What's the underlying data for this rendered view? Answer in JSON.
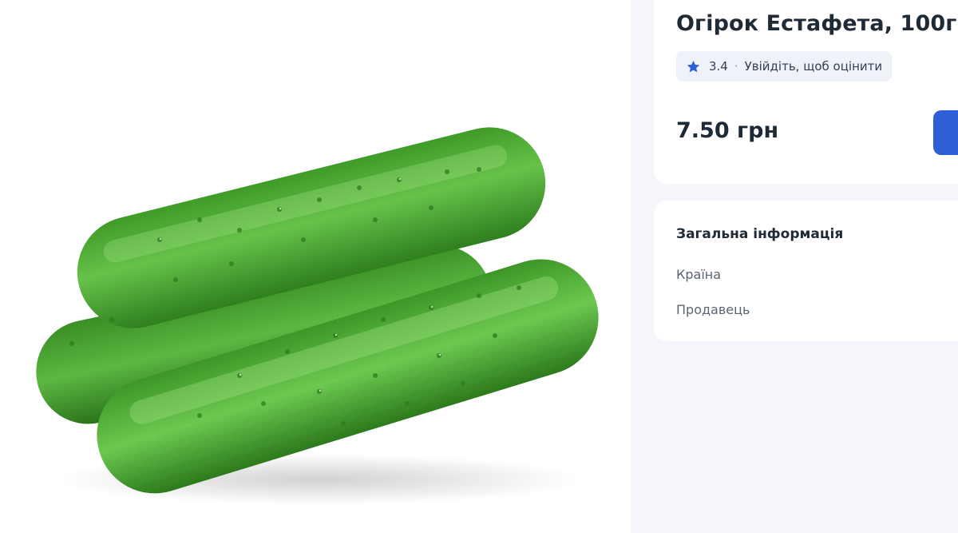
{
  "product": {
    "title": "Огірок Естафета, 100г",
    "rating": {
      "value": "3.4",
      "separator": "·",
      "login_prompt": "Увійдіть, щоб оцінити",
      "icon": "star-icon"
    },
    "price": "7.50 грн",
    "image_alt": "cucumbers"
  },
  "general_info": {
    "title": "Загальна інформація",
    "rows": [
      {
        "label": "Країна"
      },
      {
        "label": "Продавець"
      }
    ]
  },
  "colors": {
    "accent": "#2f5fd6",
    "star": "#2f5fd6",
    "text_primary": "#1f2a37",
    "text_secondary": "#5b6472",
    "panel_bg": "#f4f6fb",
    "card_bg": "#ffffff",
    "cucumber_green": "#4fa82f"
  }
}
